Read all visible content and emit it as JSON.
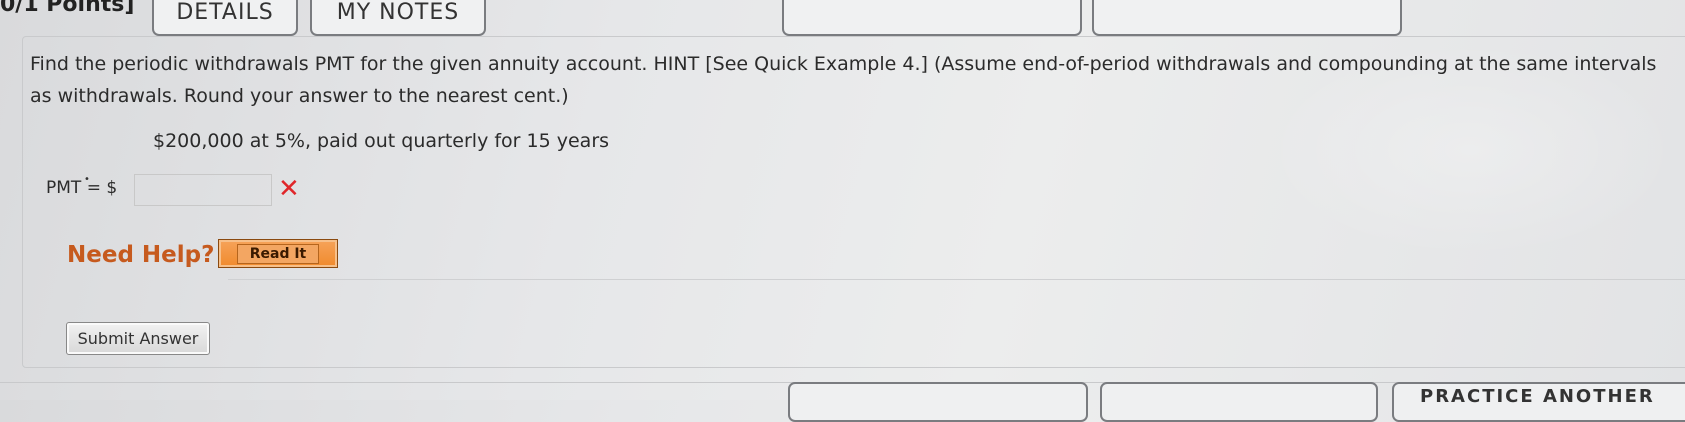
{
  "header": {
    "points_label": "0/1 Points]",
    "tabs": [
      {
        "label": "DETAILS"
      },
      {
        "label": "MY NOTES"
      }
    ]
  },
  "question": {
    "text": "Find the periodic withdrawals PMT for the given annuity account. HINT [See Quick Example 4.] (Assume end-of-period withdrawals and compounding at the same intervals as withdrawals. Round your answer to the nearest cent.)",
    "given": "$200,000 at 5%, paid out quarterly for 15 years",
    "answer_label": "PMT = $",
    "answer_value": "",
    "answer_status_icon": "wrong-x-icon"
  },
  "help": {
    "label": "Need Help?",
    "read_button": "Read It"
  },
  "actions": {
    "submit_label": "Submit Answer",
    "practice_label": "PRACTICE ANOTHER"
  },
  "colors": {
    "error": "#e0262a",
    "help_text": "#c65a1e",
    "read_button": "#f08a2c"
  }
}
